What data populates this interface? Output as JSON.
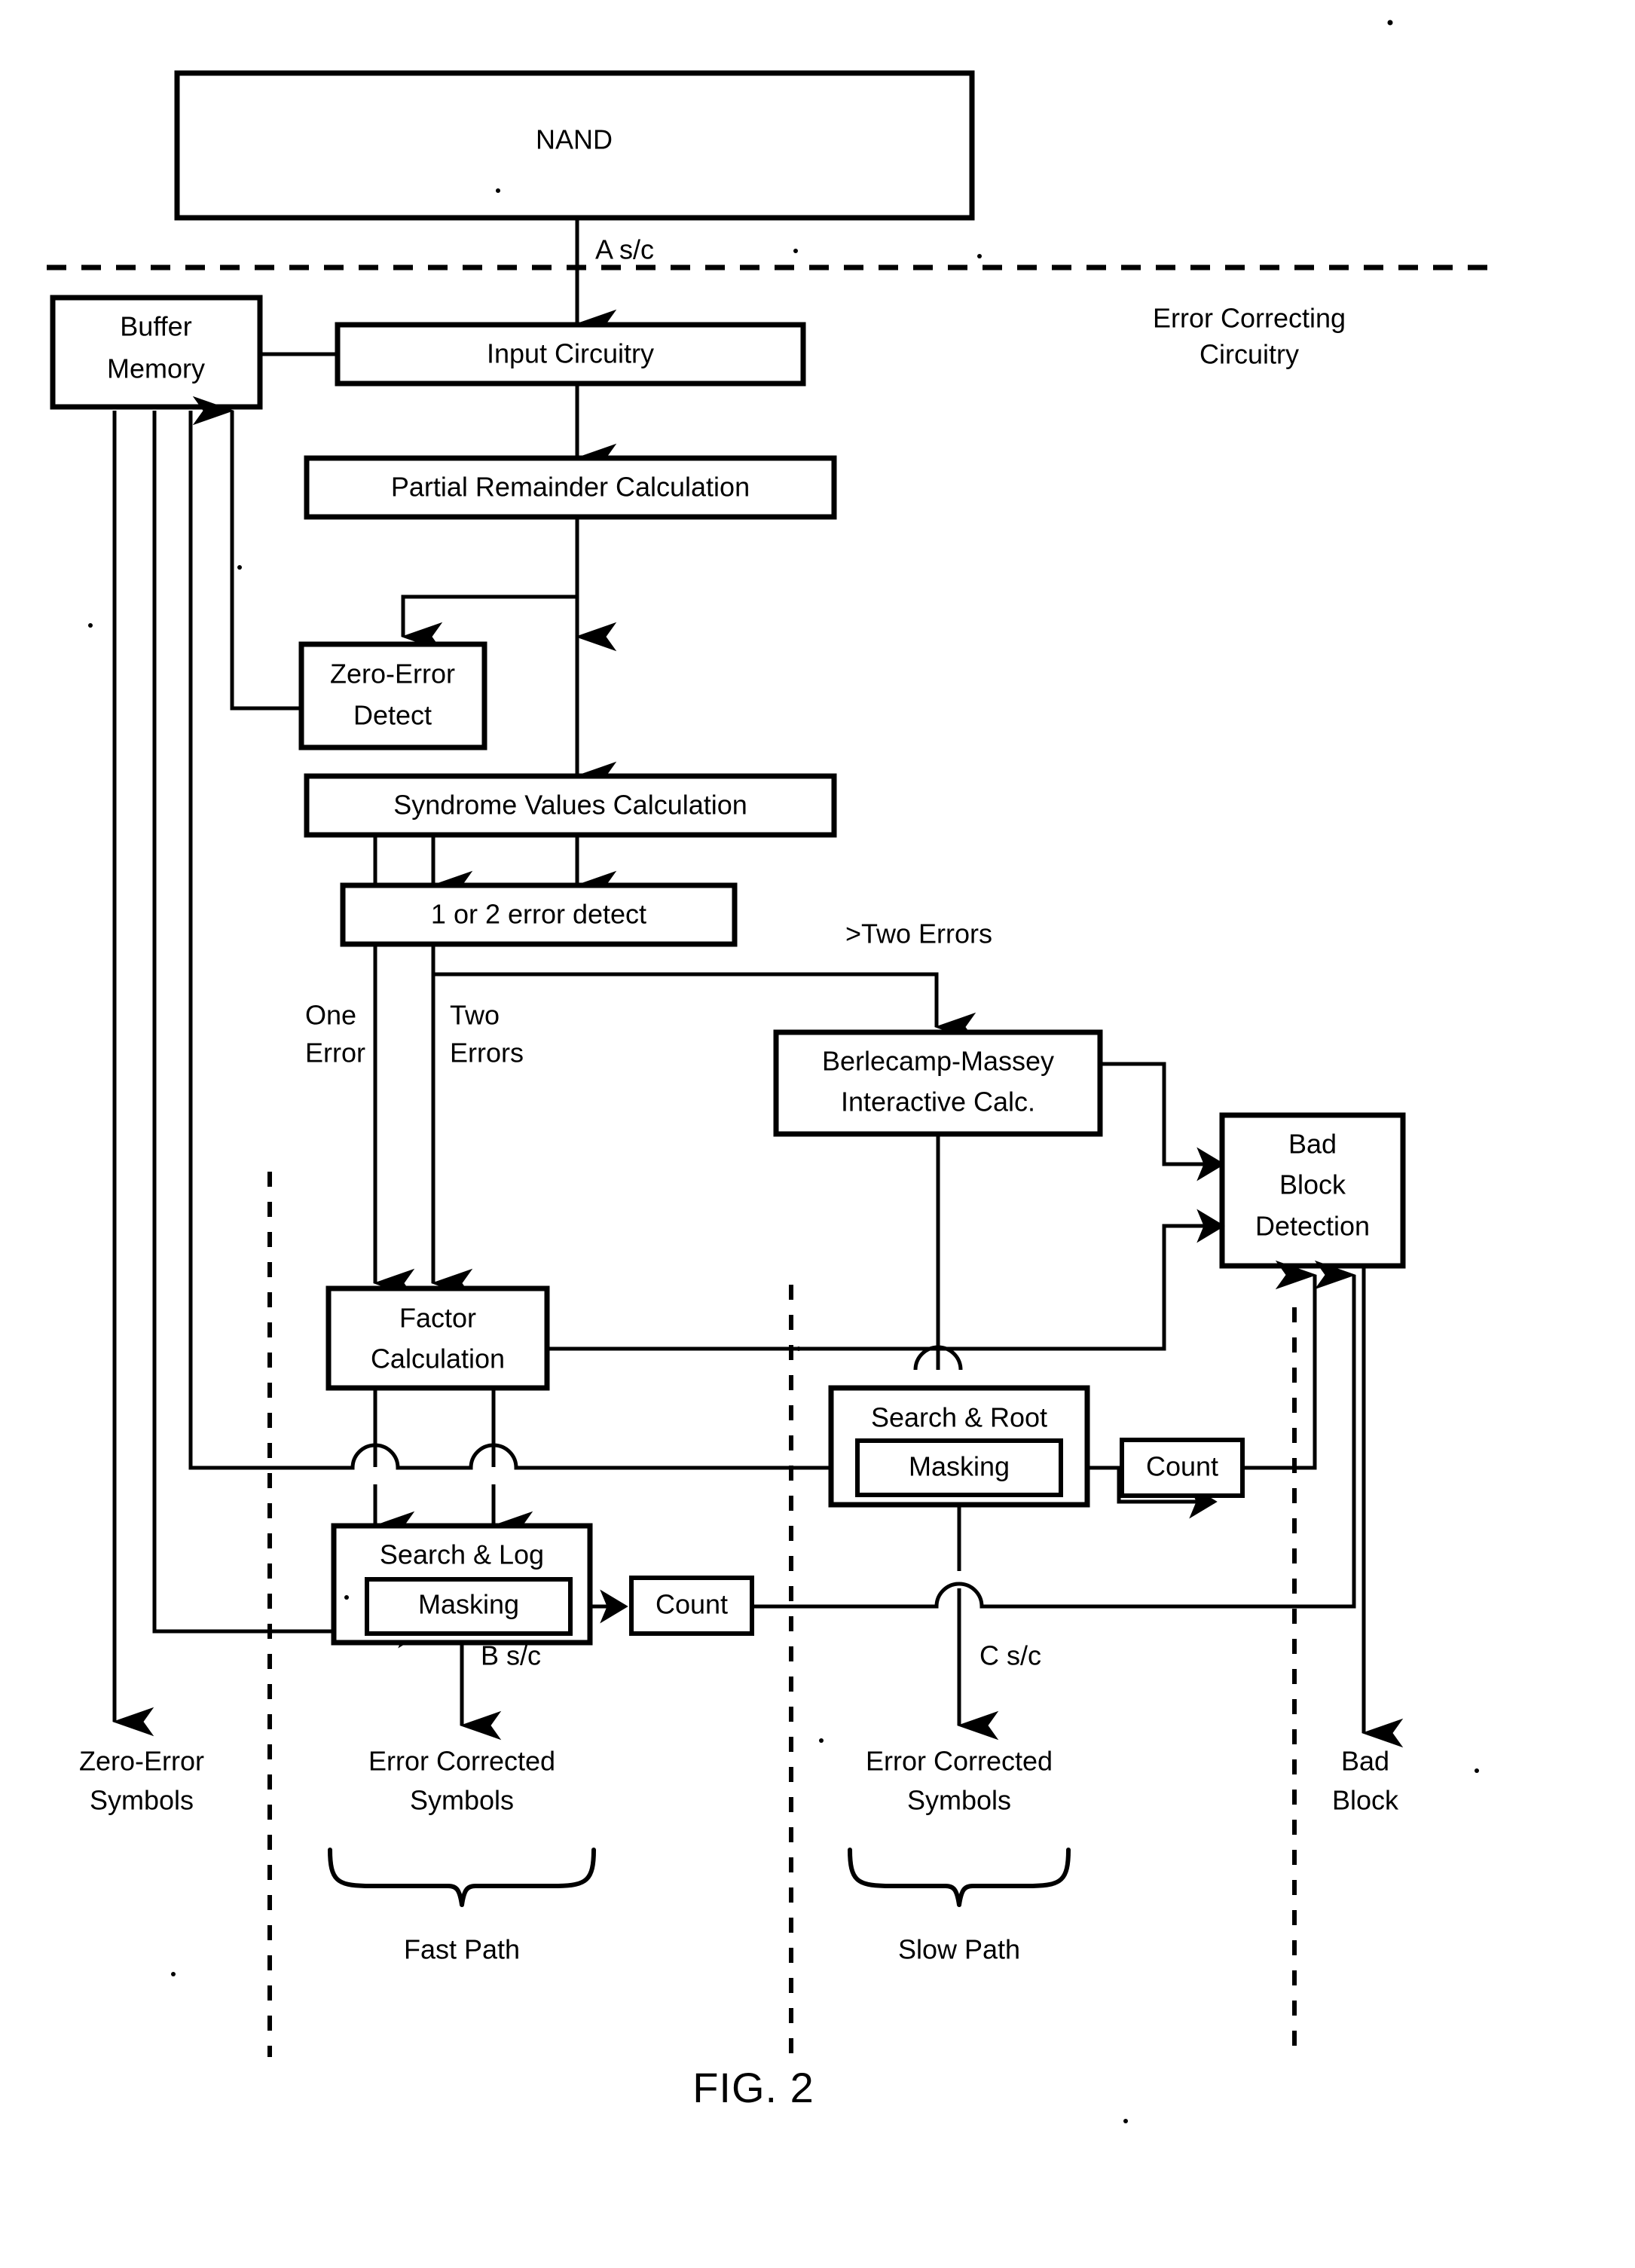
{
  "figure": {
    "caption": "FIG. 2",
    "region_label_line1": "Error Correcting",
    "region_label_line2": "Circuitry"
  },
  "blocks": {
    "nand": "NAND",
    "buffer_memory_line1": "Buffer",
    "buffer_memory_line2": "Memory",
    "input_circuitry": "Input Circuitry",
    "partial_remainder": "Partial Remainder Calculation",
    "zero_error_detect_line1": "Zero-Error",
    "zero_error_detect_line2": "Detect",
    "syndrome_values": "Syndrome Values Calculation",
    "error_detect_1or2": "1 or 2 error detect",
    "berlecamp_line1": "Berlecamp-Massey",
    "berlecamp_line2": "Interactive Calc.",
    "bad_block_detection_line1": "Bad",
    "bad_block_detection_line2": "Block",
    "bad_block_detection_line3": "Detection",
    "factor_calculation_line1": "Factor",
    "factor_calculation_line2": "Calculation",
    "search_and_root": "Search & Root",
    "search_and_root_masking": "Masking",
    "search_and_log": "Search & Log",
    "search_and_log_masking": "Masking",
    "count_fast": "Count",
    "count_slow": "Count"
  },
  "edge_labels": {
    "a_sc": "A s/c",
    "b_sc": "B s/c",
    "c_sc": "C s/c",
    "one_error_line1": "One",
    "one_error_line2": "Error",
    "two_errors_line1": "Two",
    "two_errors_line2": "Errors",
    "more_than_two_errors": ">Two Errors"
  },
  "outputs": {
    "zero_error_symbols_line1": "Zero-Error",
    "zero_error_symbols_line2": "Symbols",
    "error_corrected_fast_line1": "Error Corrected",
    "error_corrected_fast_line2": "Symbols",
    "error_corrected_slow_line1": "Error Corrected",
    "error_corrected_slow_line2": "Symbols",
    "bad_block_line1": "Bad",
    "bad_block_line2": "Block"
  },
  "path_labels": {
    "fast_path": "Fast Path",
    "slow_path": "Slow Path"
  },
  "colors": {
    "ink": "#000000",
    "paper": "#ffffff"
  }
}
